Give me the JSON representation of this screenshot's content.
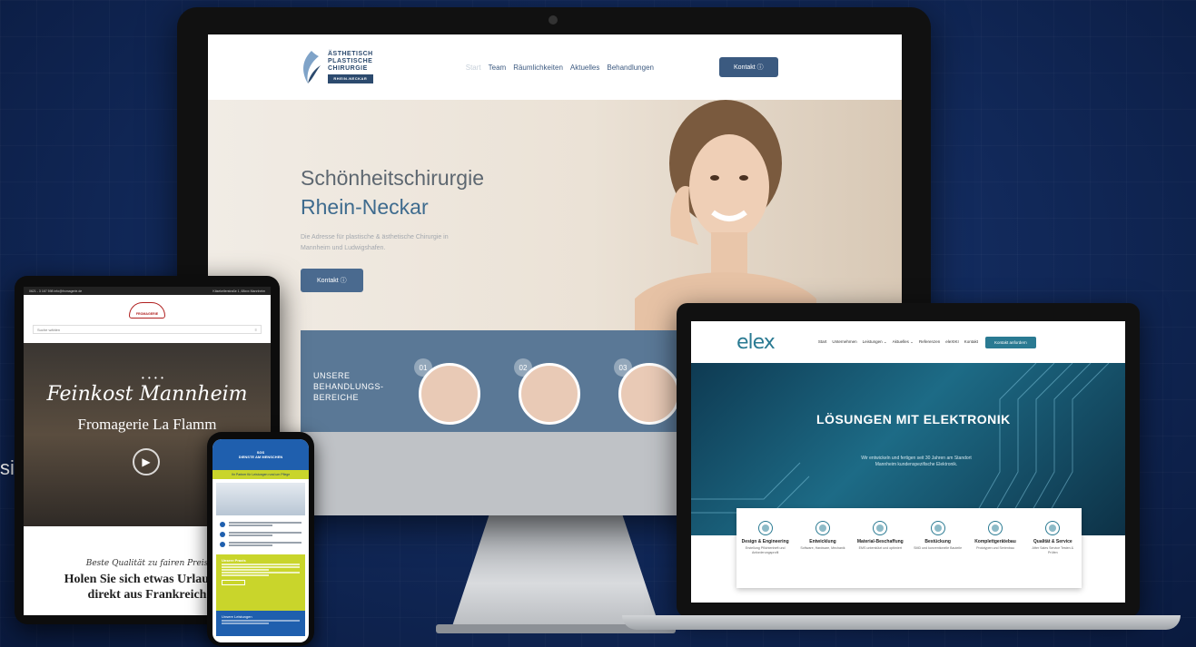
{
  "background": {
    "color": "#122a5c",
    "overlay_text": "site zu"
  },
  "imac_site": {
    "logo": {
      "line1": "ÄSTHETISCH",
      "line2": "PLASTISCHE",
      "line3": "CHIRURGIE",
      "tagline": "RHEIN-NECKAR"
    },
    "nav": [
      "Start",
      "Team",
      "Räumlichkeiten",
      "Aktuelles",
      "Behandlungen"
    ],
    "contact_button": "Kontakt ⓘ",
    "hero_title_line1": "Schönheitschirurgie",
    "hero_title_line2": "Rhein-Neckar",
    "hero_subtitle": "Die Adresse für plastische & ästhetische Chirurgie in Mannheim und Ludwigshafen.",
    "hero_button": "Kontakt ⓘ",
    "band_title": "UNSERE BEHANDLUNGS-BEREICHE",
    "band_numbers": [
      "01",
      "02",
      "03"
    ],
    "accent_color": "#3b5a80"
  },
  "laptop_site": {
    "logo": "elex",
    "nav": [
      "Start",
      "Unternehmen",
      "Leistungen ⌄",
      "Aktuelles ⌄",
      "Referenzen",
      "eleXIKI",
      "Kontakt"
    ],
    "cta_button": "Kontakt anfordern",
    "hero_title": "LÖSUNGEN MIT ELEKTRONIK",
    "hero_subtitle": "Wir entwickeln und fertigen seit 30 Jahren am Standort Mannheim kundenspezifische Elektronik.",
    "features": [
      {
        "title": "Design & Engineering",
        "desc": "Erstellung Pflichtenheft und Anforderungsprofil"
      },
      {
        "title": "Entwicklung",
        "desc": "Software, Hardware, Mechanik"
      },
      {
        "title": "Material-Beschaffung",
        "desc": "EMS unterstützt und optimiert"
      },
      {
        "title": "Bestückung",
        "desc": "SMD und konventionelle Bauteile"
      },
      {
        "title": "Komplettgerätebau",
        "desc": "Prototypen und Serienbau"
      },
      {
        "title": "Qualität & Service",
        "desc": "After Sales Service Testen & Prüfen"
      }
    ],
    "accent_color": "#2a7a92"
  },
  "tablet_site": {
    "topbar_left": "0621 - 3 167 598   info@fromagerie.de",
    "topbar_right": "Käsekellerstraße 1, 68xxx Mannheim",
    "logo": "FROMAGERIE",
    "search_placeholder": "Suche wählen",
    "hero_dots": "• • • •",
    "hero_title": "Feinkost Mannheim",
    "hero_subtitle": "Fromagerie La Flamm",
    "play_icon": "▶",
    "script_line": "Beste Qualität zu fairen Preis",
    "headline_line1": "Holen Sie sich etwas Urlaubsst",
    "headline_line2": "direkt aus Frankreich"
  },
  "phone_site": {
    "header_logo_line1": "SGS",
    "header_logo_line2": "DIENSTE AM MENSCHEN",
    "yellow_bar": "Ihr Partner für Leistungen rund um Pflege",
    "yellow_box_title": "Unsere Praxis",
    "blue_box_title": "Unsere Leistungen",
    "accent_color": "#1f5fae",
    "highlight_color": "#c9d52b"
  }
}
